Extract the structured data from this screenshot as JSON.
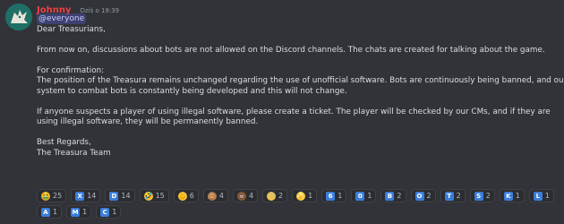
{
  "message": {
    "author": "Johnny",
    "timestamp": "Dziś o 19:39",
    "mention": "@everyone",
    "lines": [
      "Dear Treasurians,",
      "",
      "From now on, discussions about bots are not allowed on the Discord channels. The chats are created for talking about the game.",
      "",
      "For confirmation:",
      "The position of the Treasura remains unchanged regarding the use of unofficial software. Bots are continuously being banned, and our",
      "system to combat bots is constantly being developed and this will not change.",
      "",
      "If anyone suspects a player of using illegal software, please create a ticket. The player will be checked by our CMs, and if they are",
      "using illegal software, they will be permanently banned.",
      "",
      "Best Regards,",
      "The Treasura Team"
    ]
  },
  "reactions": [
    {
      "icon": "vomiting-face-icon",
      "kind": "emoji",
      "glyph": "🤮",
      "bg": "#f0a040",
      "count": "25"
    },
    {
      "icon": "letter-x-icon",
      "kind": "kbd",
      "glyph": "X",
      "count": "14"
    },
    {
      "icon": "letter-d-icon",
      "kind": "kbd",
      "glyph": "D",
      "count": "14"
    },
    {
      "icon": "rolling-laughing-icon",
      "kind": "emoji",
      "glyph": "🤣",
      "bg": "#f5c33b",
      "count": "15"
    },
    {
      "icon": "middle-finger-icon",
      "kind": "emoji",
      "glyph": "🖕",
      "bg": "#f5c33b",
      "count": "6"
    },
    {
      "icon": "see-no-evil-monkey-icon",
      "kind": "emoji",
      "glyph": "🙈",
      "bg": "#a8744f",
      "count": "4"
    },
    {
      "icon": "poop-icon",
      "kind": "emoji",
      "glyph": "💩",
      "bg": "#8b5a2b",
      "count": "4"
    },
    {
      "icon": "smiling-face-icon",
      "kind": "emoji",
      "glyph": "😊",
      "bg": "#f5c33b",
      "count": "2"
    },
    {
      "icon": "banana-icon",
      "kind": "emoji",
      "glyph": "🍌",
      "bg": "#f5d33b",
      "count": "1"
    },
    {
      "icon": "digit-6-icon",
      "kind": "kbd",
      "glyph": "6",
      "count": "1"
    },
    {
      "icon": "digit-0-icon",
      "kind": "kbd",
      "glyph": "0",
      "count": "1"
    },
    {
      "icon": "letter-b-icon",
      "kind": "kbd",
      "glyph": "B",
      "count": "2"
    },
    {
      "icon": "letter-o-icon",
      "kind": "kbd",
      "glyph": "O",
      "count": "2"
    },
    {
      "icon": "letter-t-icon",
      "kind": "kbd",
      "glyph": "T",
      "count": "2"
    },
    {
      "icon": "letter-s-icon",
      "kind": "kbd",
      "glyph": "S",
      "count": "2"
    },
    {
      "icon": "letter-k-icon",
      "kind": "kbd",
      "glyph": "K",
      "count": "1"
    },
    {
      "icon": "letter-l-icon",
      "kind": "kbd",
      "glyph": "L",
      "count": "1"
    },
    {
      "icon": "letter-a-icon",
      "kind": "kbd",
      "glyph": "A",
      "count": "1"
    },
    {
      "icon": "letter-m-icon",
      "kind": "kbd",
      "glyph": "M",
      "count": "1"
    },
    {
      "icon": "letter-c-icon",
      "kind": "kbd",
      "glyph": "C",
      "count": "1"
    }
  ],
  "colors": {
    "background": "#313338",
    "author": "#f23f43",
    "mention_bg": "#3c4270",
    "keycap": "#3b7dd8"
  }
}
